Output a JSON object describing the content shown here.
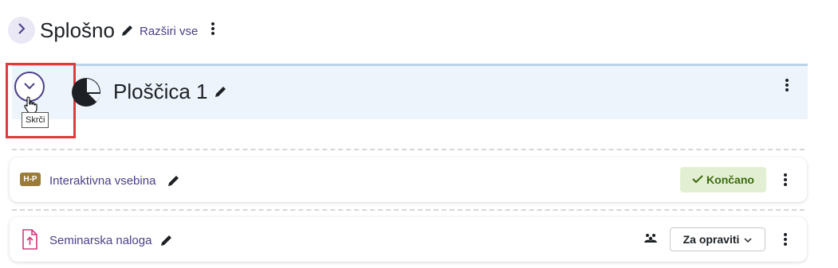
{
  "section": {
    "title": "Splošno",
    "expand_all_label": "Razširi vse"
  },
  "tile": {
    "title": "Ploščica 1",
    "tooltip": "Skrči"
  },
  "activities": [
    {
      "icon": "h5p-icon",
      "icon_text": "H-P",
      "name": "Interaktivna vsebina",
      "status": "Končano"
    },
    {
      "icon": "upload-file-icon",
      "name": "Seminarska naloga",
      "action": "Za opraviti"
    }
  ],
  "colors": {
    "accent": "#4a3f8a",
    "tile_bg": "#eef4fb",
    "done_bg": "#e3efd2",
    "done_text": "#3a6b10",
    "h5p_badge": "#9a7b3a",
    "assign_icon": "#d6387c",
    "highlight": "#e0393e"
  }
}
